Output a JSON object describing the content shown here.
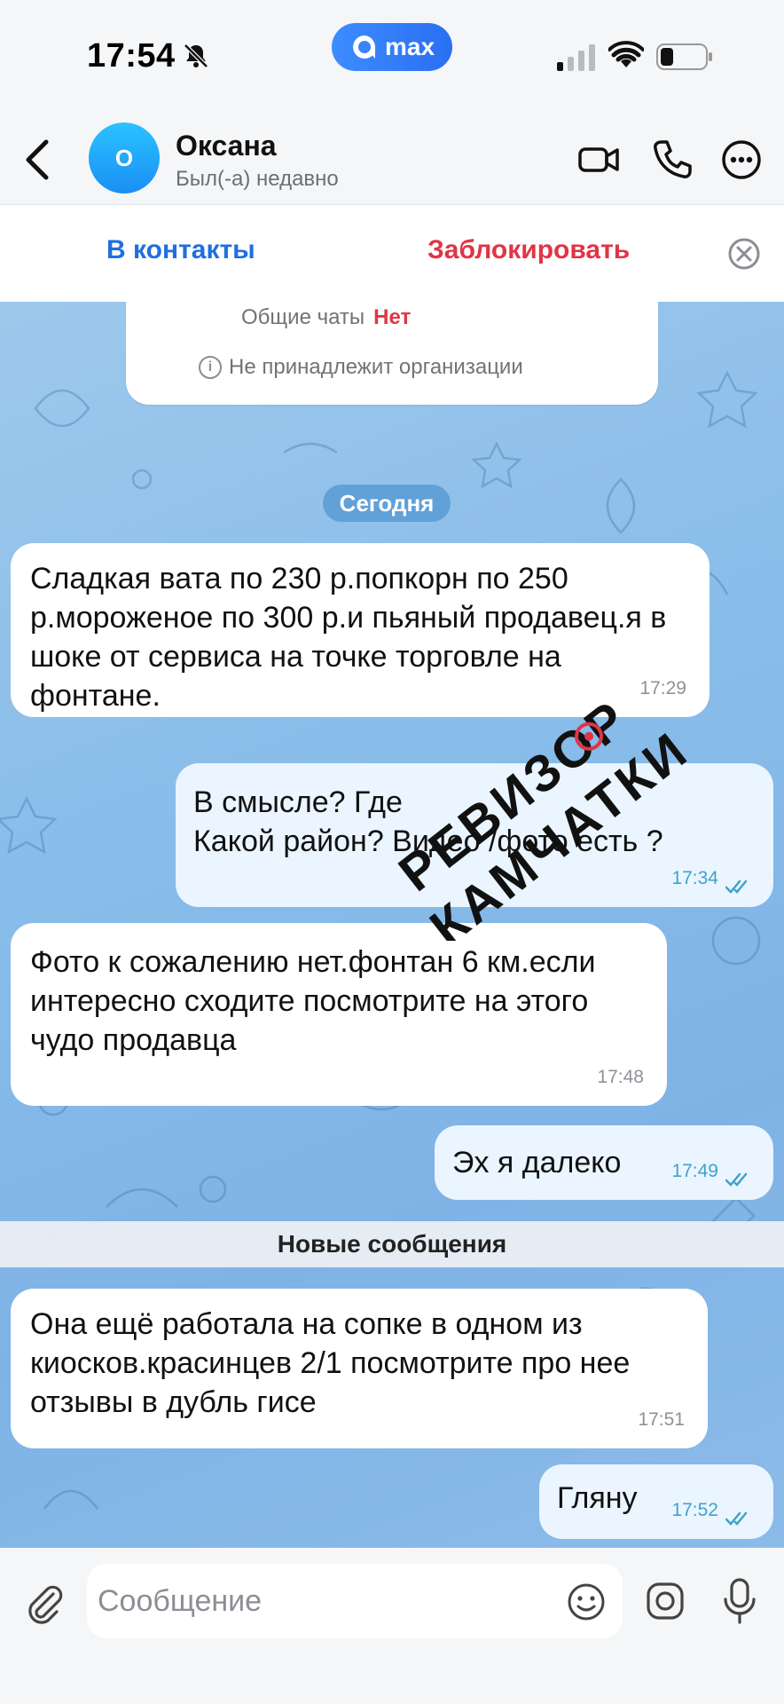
{
  "status_bar": {
    "time": "17:54",
    "app_badge": "max"
  },
  "header": {
    "avatar_letter": "О",
    "name": "Оксана",
    "status": "Был(-а) недавно"
  },
  "actions": {
    "add_contact": "В контакты",
    "block": "Заблокировать"
  },
  "info_card": {
    "common_chats_label": "Общие чаты",
    "common_chats_value": "Нет",
    "organization": "Не принадлежит организации"
  },
  "date_separator": "Сегодня",
  "messages": [
    {
      "direction": "in",
      "text": "Сладкая вата по 230 р.попкорн по 250 р.мороженое по 300 р.и пьяный продавец.я в шоке от сервиса на точке торговле на фонтане.",
      "time": "17:29"
    },
    {
      "direction": "out",
      "text": "В смысле? Где\nКакой район? Видео /фото есть ?",
      "time": "17:34",
      "read": true
    },
    {
      "direction": "in",
      "text": "Фото к сожалению нет.фонтан 6 км.если интересно сходите посмотрите на этого чудо продавца",
      "time": "17:48"
    },
    {
      "direction": "out",
      "text": "Эх я далеко",
      "time": "17:49",
      "read": true
    },
    {
      "direction": "in",
      "text": "Она ещё работала на сопке в одном из киосков.красинцев 2/1 посмотрите про нее отзывы в дубль гисе",
      "time": "17:51"
    },
    {
      "direction": "out",
      "text": "Гляну",
      "time": "17:52",
      "read": true
    }
  ],
  "new_messages_divider": "Новые сообщения",
  "watermark": {
    "line1": "РЕВИЗОР",
    "line2": "КАМЧАТКИ"
  },
  "composer": {
    "placeholder": "Сообщение"
  },
  "colors": {
    "accent_blue": "#1f6fe0",
    "block_red": "#e03545",
    "outgoing_bubble": "#eaf5ff",
    "chat_background": "#88bce9"
  }
}
